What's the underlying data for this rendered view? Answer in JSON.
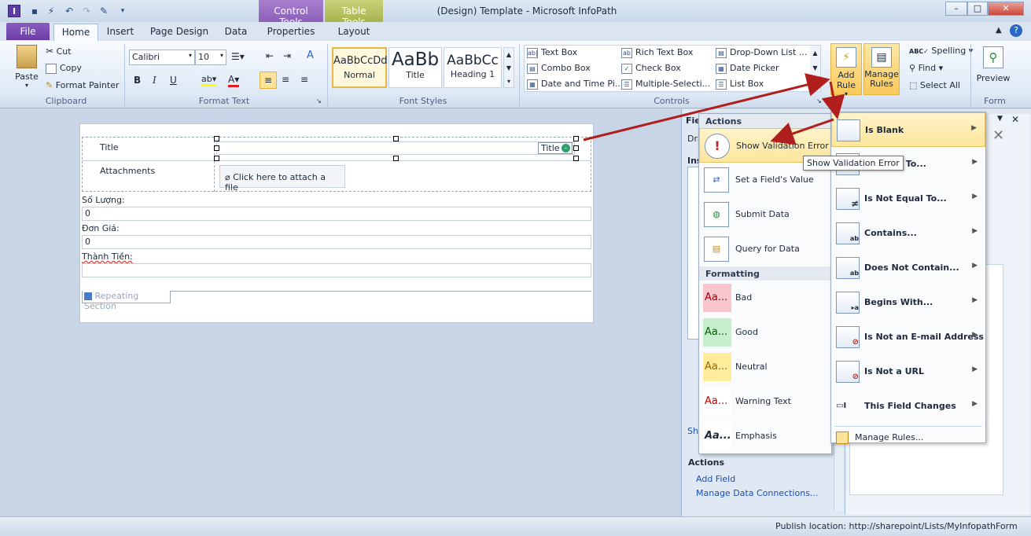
{
  "window": {
    "title": "(Design) Template - Microsoft InfoPath",
    "app_icon": "I"
  },
  "context_tabs": {
    "control_tools": "Control Tools",
    "table_tools": "Table Tools"
  },
  "tabs": [
    "File",
    "Home",
    "Insert",
    "Page Design",
    "Data",
    "Properties",
    "Layout"
  ],
  "clipboard": {
    "paste": "Paste",
    "cut": "Cut",
    "copy": "Copy",
    "format_painter": "Format Painter",
    "label": "Clipboard"
  },
  "format_text": {
    "font": "Calibri",
    "size": "10",
    "bold": "B",
    "italic": "I",
    "underline": "U",
    "label": "Format Text"
  },
  "font_styles": {
    "label": "Font Styles",
    "styles": [
      {
        "sample": "AaBbCcDd",
        "name": "Normal"
      },
      {
        "sample": "AaBb",
        "name": "Title"
      },
      {
        "sample": "AaBbCc",
        "name": "Heading 1"
      }
    ]
  },
  "controls": {
    "label": "Controls",
    "items": [
      "Text Box",
      "Rich Text Box",
      "Drop-Down List ...",
      "Combo Box",
      "Check Box",
      "Date Picker",
      "Date and Time Pi...",
      "Multiple-Selecti...",
      "List Box"
    ]
  },
  "rules": {
    "add_rule": "Add Rule",
    "manage_rules": "Manage Rules"
  },
  "editing": {
    "spelling": "Spelling",
    "find": "Find",
    "select_all": "Select All"
  },
  "form": {
    "preview": "Preview",
    "label": "Form"
  },
  "form_fields": {
    "title_label": "Title",
    "attachments_label": "Attachments",
    "attach_text": "Click here to attach a file",
    "title_tag": "Title",
    "so_luong_label": "Số Lượng:",
    "so_luong_value": "0",
    "don_gia_label": "Đơn Giá:",
    "don_gia_value": "0",
    "thanh_tien_label": "Thành Tiền:",
    "repeating_section": "Repeating Section"
  },
  "actions_menu": {
    "actions_header": "Actions",
    "actions": [
      "Show Validation Error",
      "Set a Field's Value",
      "Submit Data",
      "Query for Data"
    ],
    "formatting_header": "Formatting",
    "formatting": [
      {
        "sample": "Aa...",
        "name": "Bad",
        "bg": "#f8c7ce",
        "fg": "#9c0006"
      },
      {
        "sample": "Aa...",
        "name": "Good",
        "bg": "#c6efce",
        "fg": "#006100"
      },
      {
        "sample": "Aa...",
        "name": "Neutral",
        "bg": "#ffeb9c",
        "fg": "#9c6500"
      },
      {
        "sample": "Aa...",
        "name": "Warning Text",
        "bg": "#ffffff",
        "fg": "#c00000"
      },
      {
        "sample": "Aa...",
        "name": "Emphasis",
        "bg": "#ffffff",
        "fg": "#1e2a3c"
      }
    ]
  },
  "tooltip": "Show Validation Error",
  "rule_menu": {
    "items": [
      "Is Blank",
      "Is Equal To...",
      "Is Not Equal To...",
      "Contains...",
      "Does Not Contain...",
      "Begins With...",
      "Is Not an E-mail Address",
      "Is Not a URL",
      "This Field Changes"
    ],
    "manage": "Manage Rules..."
  },
  "taskpane": {
    "fields_label": "Fiel",
    "drag_label": "Dra",
    "insert_label": "Ins",
    "show_label": "Sh",
    "actions_header": "Actions",
    "add_field": "Add Field",
    "manage_connections": "Manage Data Connections..."
  },
  "status": {
    "publish": "Publish location: http://sharepoint/Lists/MyInfopathForm"
  }
}
